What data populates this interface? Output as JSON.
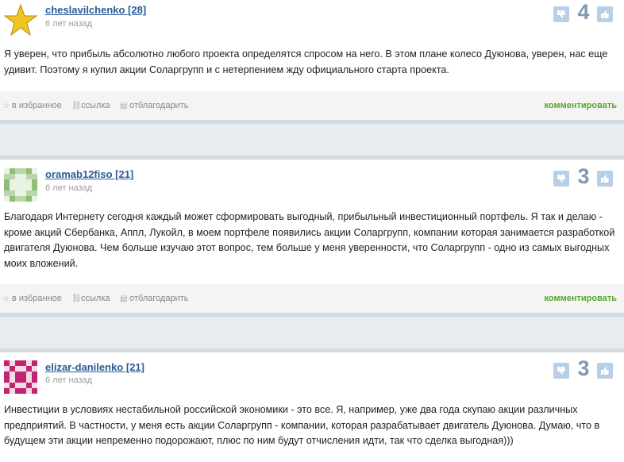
{
  "comments": [
    {
      "author": "cheslavilchenko [28]",
      "time": "6 лет назад",
      "score": "4",
      "avatar_icon": "star-avatar",
      "text": "Я уверен, что прибыль абсолютно любого проекта определятся спросом на него. В этом плане колесо Дуюнова, уверен, нас еще удивит. Поэтому я купил акции Соларгрупп и с нетерпением жду официального старта проекта.",
      "actions": {
        "favorite": "в избранное",
        "link": "ссылка",
        "thank": "отблагодарить",
        "reply": "комментировать"
      }
    },
    {
      "author": "oramab12fiso [21]",
      "time": "6 лет назад",
      "score": "3",
      "avatar_icon": "green-pattern-avatar",
      "text": "Благодаря Интернету сегодня каждый может сформировать выгодный, прибыльный инвестиционный портфель. Я так и делаю - кроме акций Сбербанка, Аппл, Лукойл, в моем портфеле появились акции Соларгрупп, компании которая занимается разработкой двигателя Дуюнова. Чем больше изучаю этот вопрос, тем больше у меня уверенности, что Соларгрупп - одно из самых выгодных моих вложений.",
      "actions": {
        "favorite": "в избранное",
        "link": "ссылка",
        "thank": "отблагодарить",
        "reply": "комментировать"
      }
    },
    {
      "author": "elizar-danilenko [21]",
      "time": "6 лет назад",
      "score": "3",
      "avatar_icon": "magenta-pattern-avatar",
      "text": "Инвестиции в условиях нестабильной российской экономики - это все. Я, например, уже два года скупаю акции различных предприятий. В частности, у меня есть акции Соларгрупп - компании, которая разрабатывает двигатель Дуюнова. Думаю, что в будущем эти акции непременно подорожают, плюс по ним будут отчисления идти, так что сделка выгодная)))"
    }
  ],
  "colors": {
    "author": "#2a5c99",
    "reply": "#59a52c",
    "score": "#8199b3",
    "vote_button": "#b9cfe6"
  }
}
